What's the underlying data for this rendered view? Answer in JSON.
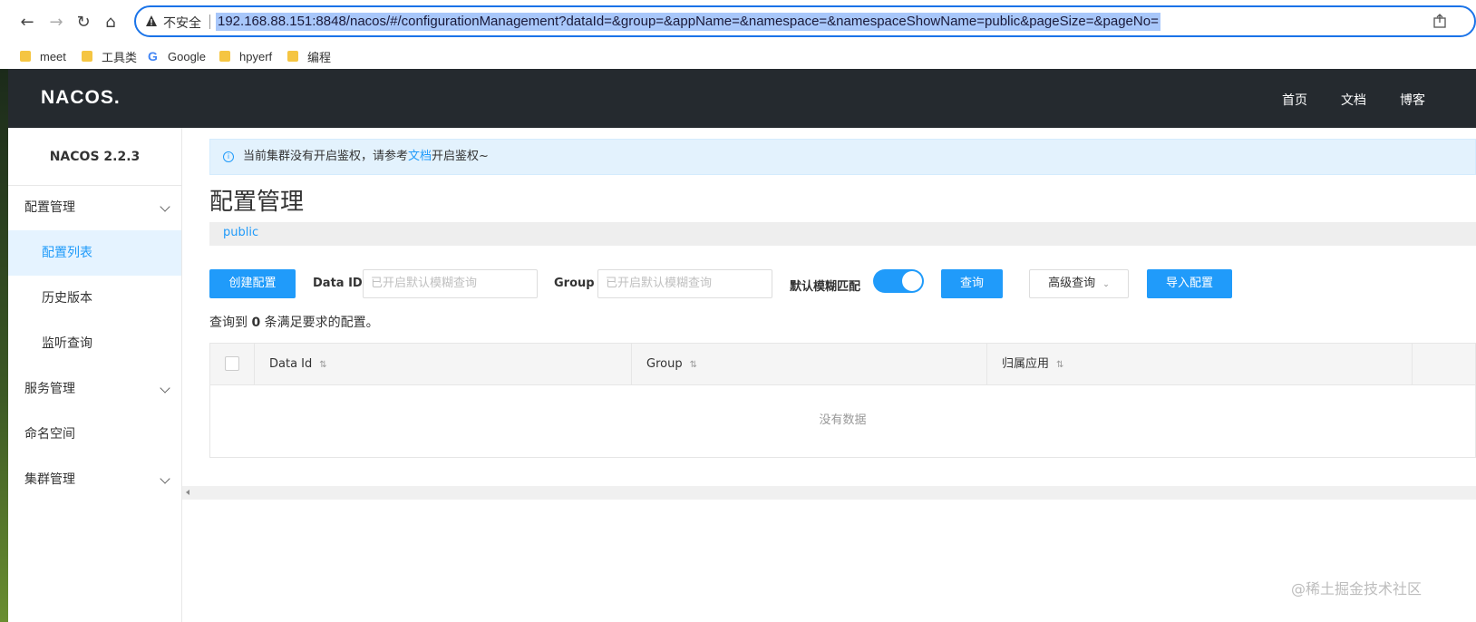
{
  "browser": {
    "insecure_label": "不安全",
    "url": "192.168.88.151:8848/nacos/#/configurationManagement?dataId=&group=&appName=&namespace=&namespaceShowName=public&pageSize=&pageNo=",
    "bookmarks": [
      {
        "label": "meet",
        "icon": "folder-icon"
      },
      {
        "label": "工具类",
        "icon": "folder-icon"
      },
      {
        "label": "Google",
        "icon": "google-icon"
      },
      {
        "label": "hpyerf",
        "icon": "folder-icon"
      },
      {
        "label": "编程",
        "icon": "folder-icon"
      }
    ]
  },
  "header": {
    "logo": "NACOS.",
    "nav": [
      "首页",
      "文档",
      "博客"
    ]
  },
  "sidebar": {
    "version": "NACOS 2.2.3",
    "items": [
      {
        "label": "配置管理",
        "type": "group"
      },
      {
        "label": "配置列表",
        "type": "sub",
        "active": true
      },
      {
        "label": "历史版本",
        "type": "sub"
      },
      {
        "label": "监听查询",
        "type": "sub"
      },
      {
        "label": "服务管理",
        "type": "group"
      },
      {
        "label": "命名空间",
        "type": "top"
      },
      {
        "label": "集群管理",
        "type": "group"
      }
    ]
  },
  "notice": {
    "prefix": "当前集群没有开启鉴权，请参考",
    "link": "文档",
    "suffix": "开启鉴权~"
  },
  "page": {
    "title": "配置管理",
    "namespace": "public"
  },
  "toolbar": {
    "create_label": "创建配置",
    "dataid_label": "Data ID",
    "dataid_placeholder": "已开启默认模糊查询",
    "group_label": "Group",
    "group_placeholder": "已开启默认模糊查询",
    "fuzzy_label": "默认模糊匹配",
    "fuzzy_on": true,
    "query_label": "查询",
    "advanced_label": "高级查询",
    "import_label": "导入配置"
  },
  "result": {
    "prefix": "查询到",
    "count": "0",
    "suffix": "条满足要求的配置。"
  },
  "table": {
    "columns": [
      "Data Id",
      "Group",
      "归属应用"
    ],
    "empty_text": "没有数据"
  },
  "watermark": "@稀土掘金技术社区",
  "colors": {
    "accent": "#209bfa",
    "header_bg": "#252a2f",
    "notice_bg": "#e3f2fd"
  }
}
